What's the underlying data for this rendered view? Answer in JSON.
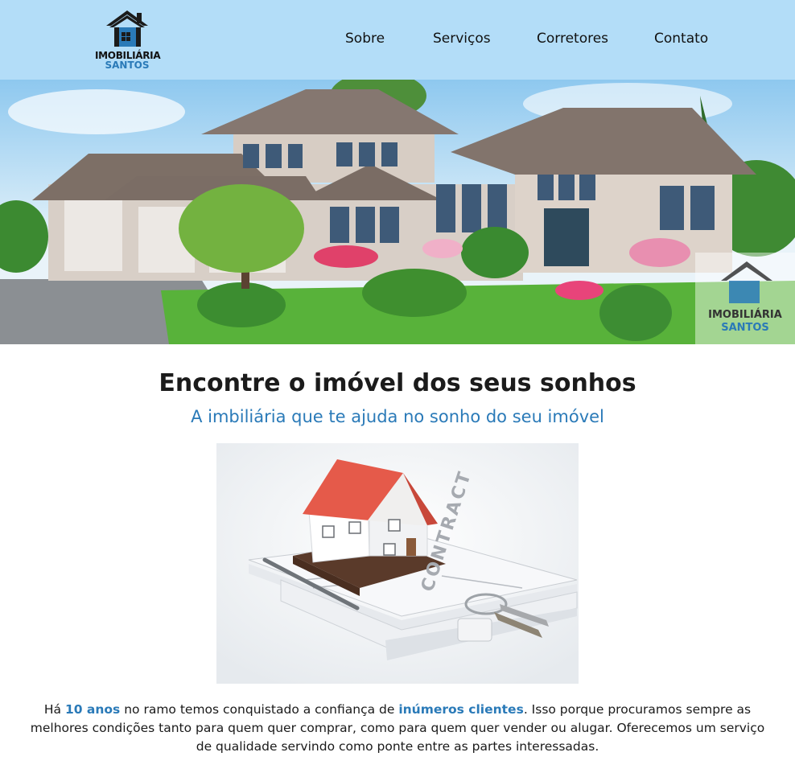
{
  "brand": {
    "name_line1": "IMOBILIÁRIA",
    "name_line2": "SANTOS",
    "blue": "#2a7ab8",
    "header_bg": "#b3ddf8"
  },
  "nav": {
    "items": [
      {
        "label": "Sobre"
      },
      {
        "label": "Serviços"
      },
      {
        "label": "Corretores"
      },
      {
        "label": "Contato"
      }
    ]
  },
  "hero": {
    "watermark_line1": "IMOBILIÁRIA",
    "watermark_line2": "SANTOS"
  },
  "intro": {
    "title": "Encontre o imóvel dos seus sonhos",
    "subtitle": "A imbiliária que te ajuda no sonho do seu imóvel"
  },
  "photo": {
    "document_text": "CONTRACT"
  },
  "about": {
    "t1": "Há ",
    "h1": "10 anos",
    "t2": " no ramo temos conquistado a confiança de ",
    "h2": "inúmeros clientes",
    "t3": ". Isso porque procuramos sempre as melhores condições tanto para quem quer comprar, como para quem quer vender ou alugar. Oferecemos um serviço de qualidade servindo como ponte entre as partes interessadas."
  }
}
